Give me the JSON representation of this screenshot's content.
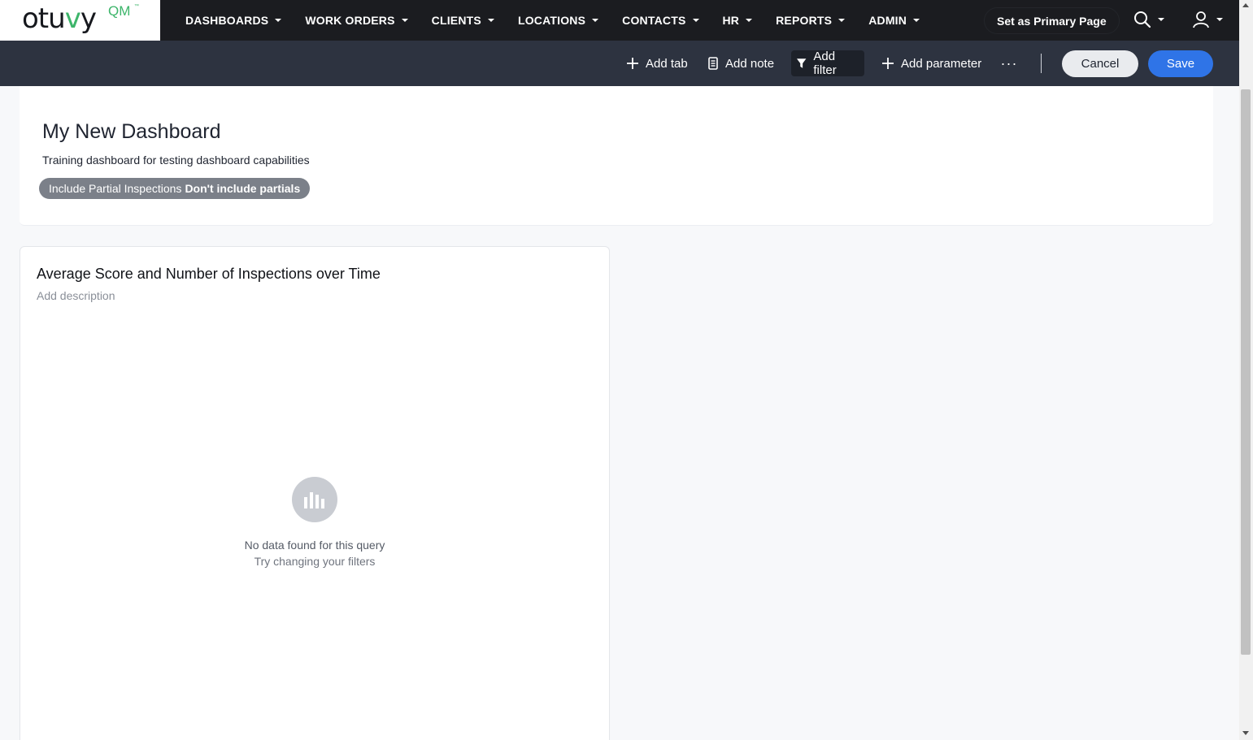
{
  "brand": {
    "logo_text_a": "otu",
    "logo_text_v": "v",
    "logo_text_b": "y",
    "logo_suffix": "QM",
    "logo_mark": "™"
  },
  "nav": {
    "items": [
      {
        "label": "DASHBOARDS"
      },
      {
        "label": "WORK ORDERS"
      },
      {
        "label": "CLIENTS"
      },
      {
        "label": "LOCATIONS"
      },
      {
        "label": "CONTACTS"
      },
      {
        "label": "HR"
      },
      {
        "label": "REPORTS"
      },
      {
        "label": "ADMIN"
      }
    ],
    "primary_page_label": "Set as Primary Page",
    "search_icon": "search-icon",
    "user_icon": "user-icon"
  },
  "toolbar": {
    "add_tab": "Add tab",
    "add_note": "Add note",
    "add_filter": "Add filter",
    "add_parameter": "Add parameter",
    "more": "···",
    "cancel": "Cancel",
    "save": "Save"
  },
  "dashboard": {
    "title": "My New Dashboard",
    "description": "Training dashboard for testing dashboard capabilities",
    "filter": {
      "name": "Include Partial Inspections",
      "value": "Don't include partials"
    }
  },
  "card": {
    "title": "Average Score and Number of Inspections over Time",
    "description_placeholder": "Add description",
    "empty_title": "No data found for this query",
    "empty_hint": "Try changing your filters"
  },
  "colors": {
    "nav_bg": "#1b1c20",
    "toolbar_bg": "#2d3340",
    "brand_green": "#3db56a",
    "save_blue": "#2f74e7",
    "chip_gray": "#7b8089"
  }
}
